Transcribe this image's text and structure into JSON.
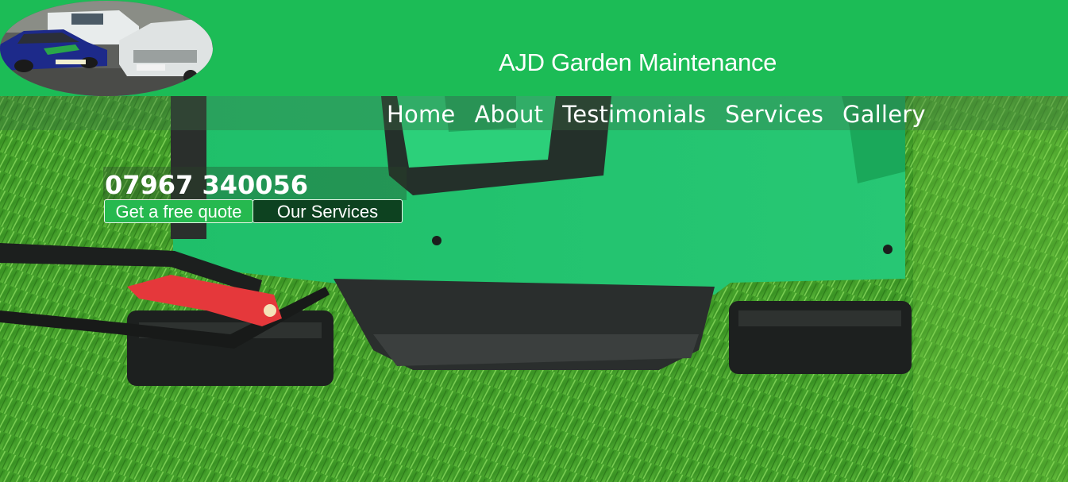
{
  "header": {
    "site_title": "AJD Garden Maintenance",
    "background_color": "#1cbc56"
  },
  "nav": {
    "items": [
      {
        "label": "Home"
      },
      {
        "label": "About"
      },
      {
        "label": "Testimonials"
      },
      {
        "label": "Services"
      },
      {
        "label": "Gallery"
      }
    ]
  },
  "hero": {
    "phone": "07967 340056",
    "quote_button": "Get a free quote",
    "services_button": "Our Services",
    "image_subject": "green lawn mower on grass"
  },
  "colors": {
    "brand_green": "#1cbc56",
    "dark_button": "#0d4220",
    "mower_green": "#22c46a",
    "grass": "#3f9a22"
  }
}
